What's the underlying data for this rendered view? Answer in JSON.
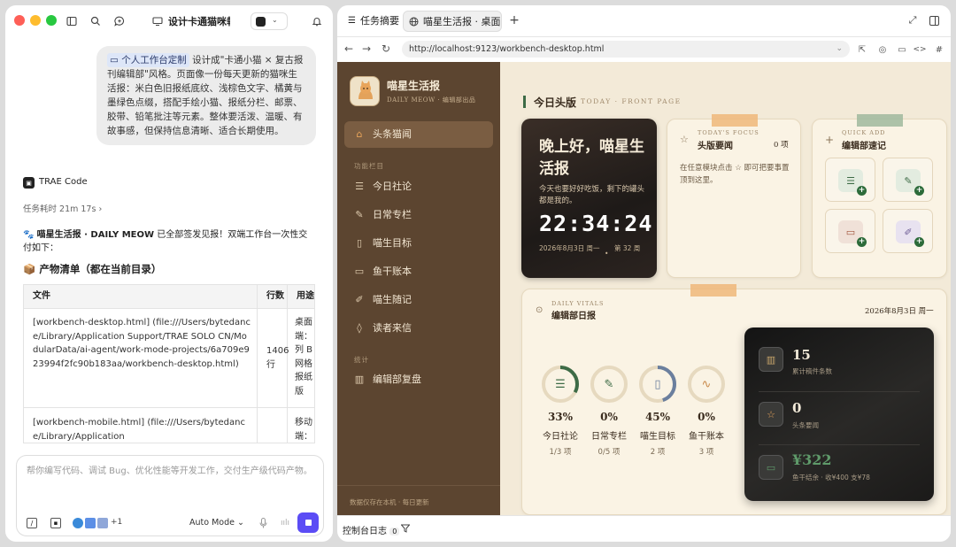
{
  "left_panel": {
    "session_title": "设计卡通猫咪報",
    "user_message": {
      "tag": "个人工作台定制",
      "text": "设计成\"卡通小猫 × 复古报刊编辑部\"风格。页面像一份每天更新的猫咪生活报：米白色旧报纸底纹、浅棕色文字、橘黄与墨绿色点缀，搭配手绘小猫、报纸分栏、邮票、胶带、铅笔批注等元素。整体要活泼、温暖、有故事感，但保持信息清晰、适合长期使用。"
    },
    "assistant_name": "TRAE Code",
    "task_time": "任务耗时 21m 17s",
    "summary_prefix": "🐾 ",
    "summary_bold": "喵星生活报 · DAILY MEOW",
    "summary_rest": " 已全部签发见报！双端工作台一次性交付如下：",
    "artifact_heading": "📦 产物清单（都在当前目录）",
    "table": {
      "headers": [
        "文件",
        "行数",
        "用途"
      ],
      "rows": [
        {
          "file": "[workbench-desktop.html] (file:///Users/bytedance/Library/Application Support/TRAE SOLO CN/ModularData/ai-agent/work-mode-projects/6a709e923994f2fc90b183aa/workbench-desktop.html)",
          "lines": "1406行",
          "usage": "桌面端：列 B 网格报纸版"
        },
        {
          "file": "[workbench-mobile.html] (file:///Users/bytedance/Library/Application",
          "lines": "",
          "usage": "移动端："
        }
      ]
    },
    "input_placeholder": "帮你编写代码、调试 Bug、优化性能等开发工作，交付生产级代码产物。",
    "plus_count": "+1",
    "mode": "Auto Mode"
  },
  "browser": {
    "tab1": "任务摘要",
    "tab2": "喵星生活报 · 桌面...",
    "url": "http://localhost:9123/workbench-desktop.html",
    "console_label": "控制台日志",
    "console_count": "0"
  },
  "app": {
    "brand_title": "喵星生活报",
    "brand_sub": "DAILY MEOW · 编辑部出品",
    "nav_active": "头条猫闻",
    "section_features": "功能栏目",
    "nav_items": [
      "今日社论",
      "日常专栏",
      "喵生目标",
      "鱼干账本",
      "喵生随记",
      "读者来信"
    ],
    "section_stats": "统计",
    "nav_stats": "编辑部复盘",
    "footer": "数据仅存在本机 · 每日更新",
    "headline_cn": "今日头版",
    "headline_en": "TODAY · FRONT PAGE",
    "greeting_card": {
      "greeting": "晚上好，喵星生活报",
      "sub": "今天也要好好吃饭，剩下的罐头都是我的。",
      "time": "22:34:24",
      "date": "2026年8月3日 周一",
      "week": "第 32 周"
    },
    "focus_card": {
      "en": "TODAY'S FOCUS",
      "title": "头版要闻",
      "count": "0 项",
      "hint": "在任意模块点击 ☆ 即可把要事置顶到这里。"
    },
    "quick_card": {
      "en": "QUICK ADD",
      "title": "编辑部速记"
    },
    "vitals_card": {
      "en": "DAILY VITALS",
      "title": "编辑部日报",
      "date": "2026年8月3日 周一",
      "stats": [
        {
          "pct": 33,
          "pct_label": "33%",
          "name": "今日社论",
          "detail": "1/3 项",
          "color": "#3d6b46",
          "icon": "list-icon"
        },
        {
          "pct": 0,
          "pct_label": "0%",
          "name": "日常专栏",
          "detail": "0/5 项",
          "color": "#3d6b46",
          "icon": "feather-icon"
        },
        {
          "pct": 45,
          "pct_label": "45%",
          "name": "喵生目标",
          "detail": "2 项",
          "color": "#6b7f9e",
          "icon": "book-icon"
        },
        {
          "pct": 0,
          "pct_label": "0%",
          "name": "鱼干账本",
          "detail": "3 项",
          "color": "#c98a4a",
          "icon": "pulse-icon"
        }
      ]
    },
    "dark_card": {
      "rows": [
        {
          "value": "15",
          "label": "累计稿件条数"
        },
        {
          "value": "0",
          "label": "头条要闻"
        },
        {
          "value": "¥322",
          "label": "鱼干结余 · 收¥400 支¥78"
        }
      ]
    }
  },
  "colors": {
    "accent_orange": "#e8a45a",
    "accent_green": "#3d6b46",
    "sidebar": "#5c4530",
    "paper": "#f3ead8",
    "send_button": "#5b4cf5"
  }
}
